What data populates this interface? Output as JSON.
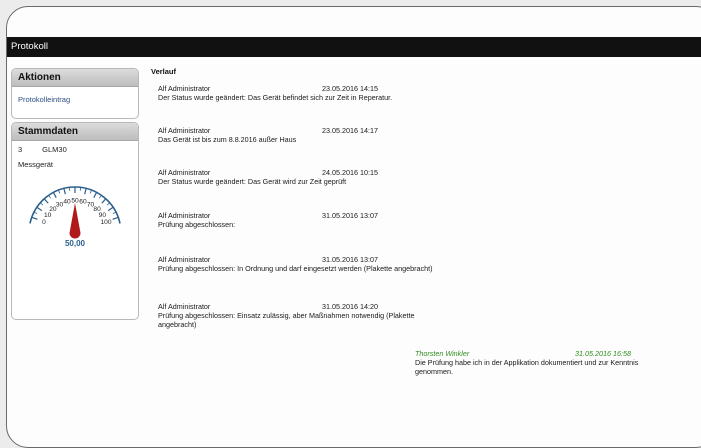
{
  "window": {
    "title": "Protokoll"
  },
  "aktionen": {
    "header": "Aktionen",
    "items": [
      {
        "label": "Protokolleintrag"
      }
    ]
  },
  "stammdaten": {
    "header": "Stammdaten",
    "id": "3",
    "model": "GLM30",
    "type": "Messgerät",
    "gauge": {
      "value": 50,
      "value_label": "50,00",
      "min": 0,
      "max": 100,
      "ticks": [
        "0",
        "10",
        "20",
        "30",
        "40",
        "50",
        "60",
        "70",
        "80",
        "90",
        "100"
      ],
      "needle_color": "#b01a1a",
      "accent": "#2b5f8c"
    }
  },
  "verlauf": {
    "title": "Verlauf",
    "entries": [
      {
        "author": "Alf Administrator",
        "date": "23.05.2016 14:15",
        "text": "Der Status wurde geändert: Das Gerät befindet sich zur Zeit in Reperatur."
      },
      {
        "author": "Alf Administrator",
        "date": "23.05.2016 14:17",
        "text": "Das Gerät ist bis zum 8.8.2016 außer Haus"
      },
      {
        "author": "Alf Administrator",
        "date": "24.05.2016 10:15",
        "text": "Der Status wurde geändert: Das Gerät wird zur Zeit geprüft"
      },
      {
        "author": "Alf Administrator",
        "date": "31.05.2016 13:07",
        "text": "Prüfung abgeschlossen:"
      },
      {
        "author": "Alf Administrator",
        "date": "31.05.2016 13:07",
        "text": "Prüfung abgeschlossen: In Ordnung und darf eingesetzt werden (Plakette angebracht)"
      },
      {
        "author": "Alf Administrator",
        "date": "31.05.2016 14:20",
        "text": "Prüfung abgeschlossen: Einsatz zulässig, aber Maßnahmen notwendig (Plakette angebracht)"
      }
    ],
    "comment": {
      "author": "Thorsten Winkler",
      "date": "31.05.2016 16:58",
      "text": "Die Prüfung habe ich in der Applikation dokumentiert und zur Kenntnis genommen.",
      "color": "#2f8d1e"
    }
  }
}
